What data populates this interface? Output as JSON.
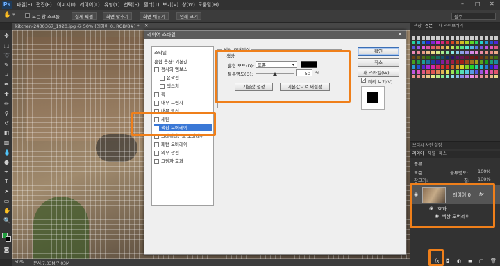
{
  "menubar": {
    "logo": "Ps",
    "items": [
      "파일(F)",
      "편집(E)",
      "이미지(I)",
      "레이어(L)",
      "유형(Y)",
      "선택(S)",
      "필터(T)",
      "보기(V)",
      "창(W)",
      "도움말(H)"
    ],
    "window_controls": [
      "–",
      "□",
      "✕"
    ]
  },
  "options_bar": {
    "scroll_all_windows": "모든 창 스크롤",
    "buttons": [
      "실제 픽셀",
      "화면 맞추기",
      "화면 채우기",
      "인쇄 크기"
    ],
    "workspace": "필수"
  },
  "document_tab": {
    "label": "kitchen-2400367_1920.jpg @ 50% (레이어 0, RGB/8#) *",
    "close": "✕"
  },
  "status_bar": {
    "zoom": "50%",
    "doc_info": "문서:7.03M/7.03M"
  },
  "dialog": {
    "title": "레이어 스타일",
    "close": "✕",
    "style_list": {
      "header": "스타일",
      "blend_options": "혼합 옵션: 기본값",
      "items": [
        {
          "label": "경사와 엠보스",
          "checked": false,
          "selected": false
        },
        {
          "label": "윤곽선",
          "checked": false,
          "selected": false
        },
        {
          "label": "텍스처",
          "checked": false,
          "selected": false
        },
        {
          "label": "획",
          "checked": false,
          "selected": false
        },
        {
          "label": "내부 그림자",
          "checked": false,
          "selected": false
        },
        {
          "label": "내부 광선",
          "checked": false,
          "selected": false
        },
        {
          "label": "새틴",
          "checked": false,
          "selected": false
        },
        {
          "label": "색상 오버레이",
          "checked": true,
          "selected": true
        },
        {
          "label": "그레이디언트 오버레이",
          "checked": false,
          "selected": false
        },
        {
          "label": "패턴 오버레이",
          "checked": false,
          "selected": false
        },
        {
          "label": "외부 광선",
          "checked": false,
          "selected": false
        },
        {
          "label": "그림자 효과",
          "checked": false,
          "selected": false
        }
      ]
    },
    "color_overlay": {
      "section_title": "색상 오버레이",
      "group_title": "색상",
      "blend_mode_label": "혼합 모드(D):",
      "blend_mode_value": "표준",
      "overlay_color": "#000000",
      "opacity_label": "불투명도(O):",
      "opacity_value": "50",
      "opacity_unit": "%",
      "opacity_fraction": 0.5,
      "make_default": "기본값 설정",
      "reset_default": "기본값으로 재설정"
    },
    "buttons": {
      "ok": "확인",
      "cancel": "취소",
      "new_style": "새 스타일(W)...",
      "preview": "미리 보기(V)"
    },
    "preview_checked": true
  },
  "right_panel": {
    "top_tabs": [
      "색상",
      "견본",
      "내 라이브러리"
    ],
    "brush_tabs": [
      "브러시 사전 설정",
      "레이어",
      "채널",
      "패스"
    ],
    "layers_tabs": [
      "레이어",
      "채널",
      "패스"
    ],
    "kind_filter": "종류",
    "blend_mode": "표준",
    "opacity_label": "불투명도:",
    "opacity_value": "100%",
    "lock_label": "잠그기:",
    "fill_label": "칠:",
    "fill_value": "100%",
    "layer_name": "레이어 0",
    "fx_badge": "fx",
    "effects_label": "효과",
    "effect_item": "색상 오버레이",
    "bottom_fx": "fx"
  }
}
